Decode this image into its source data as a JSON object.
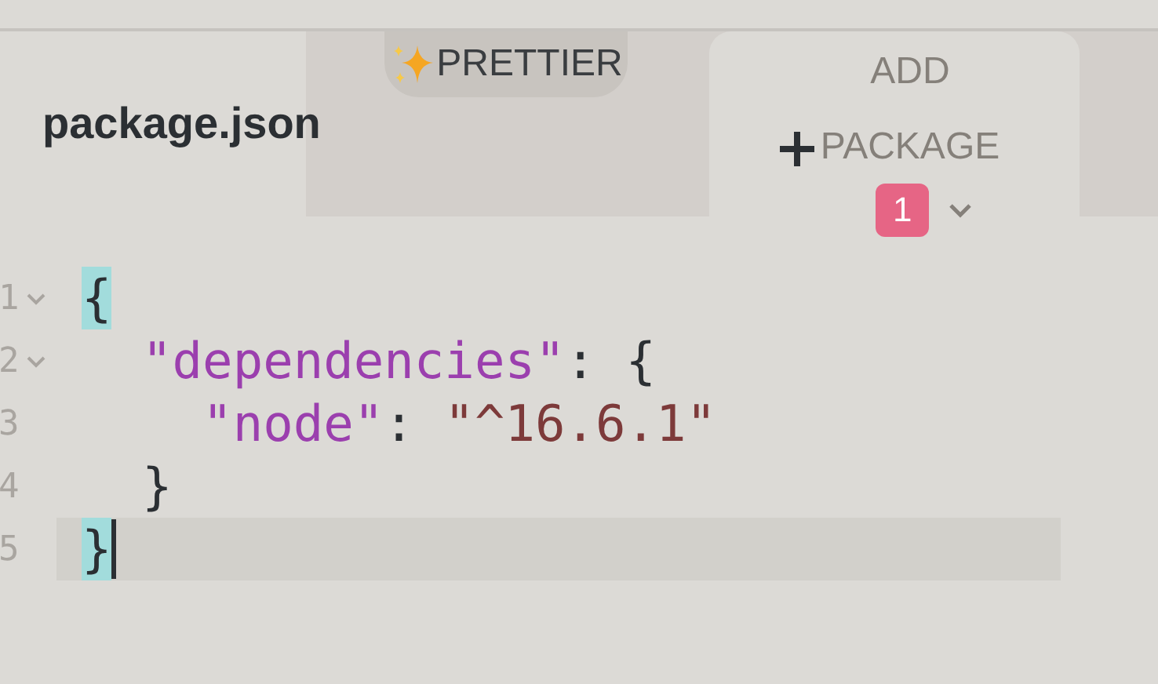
{
  "file_tab": {
    "title": "package.json"
  },
  "toolbar": {
    "prettier": {
      "label": "PRETTIER"
    },
    "add_package": {
      "label": "ADD PACKAGE",
      "badge": "1"
    }
  },
  "editor": {
    "lines": [
      {
        "number": "1",
        "foldable": true,
        "active": false,
        "tokens": [
          {
            "kind": "open_brace",
            "text": "{",
            "matched": true
          }
        ]
      },
      {
        "number": "2",
        "foldable": true,
        "active": false,
        "tokens": [
          {
            "kind": "key",
            "text": "\"dependencies\"",
            "matched": false
          },
          {
            "kind": "punct",
            "text": ": ",
            "matched": false
          },
          {
            "kind": "open_brace",
            "text": "{",
            "matched": false
          }
        ]
      },
      {
        "number": "3",
        "foldable": false,
        "active": false,
        "tokens": [
          {
            "kind": "key",
            "text": "\"node\"",
            "matched": false
          },
          {
            "kind": "punct",
            "text": ": ",
            "matched": false
          },
          {
            "kind": "string",
            "text": "\"^16.6.1\"",
            "matched": false
          }
        ]
      },
      {
        "number": "4",
        "foldable": false,
        "active": false,
        "tokens": [
          {
            "kind": "close_brace",
            "text": "}",
            "matched": false
          }
        ]
      },
      {
        "number": "5",
        "foldable": false,
        "active": true,
        "tokens": [
          {
            "kind": "close_brace",
            "text": "}",
            "matched": true
          }
        ]
      }
    ]
  }
}
